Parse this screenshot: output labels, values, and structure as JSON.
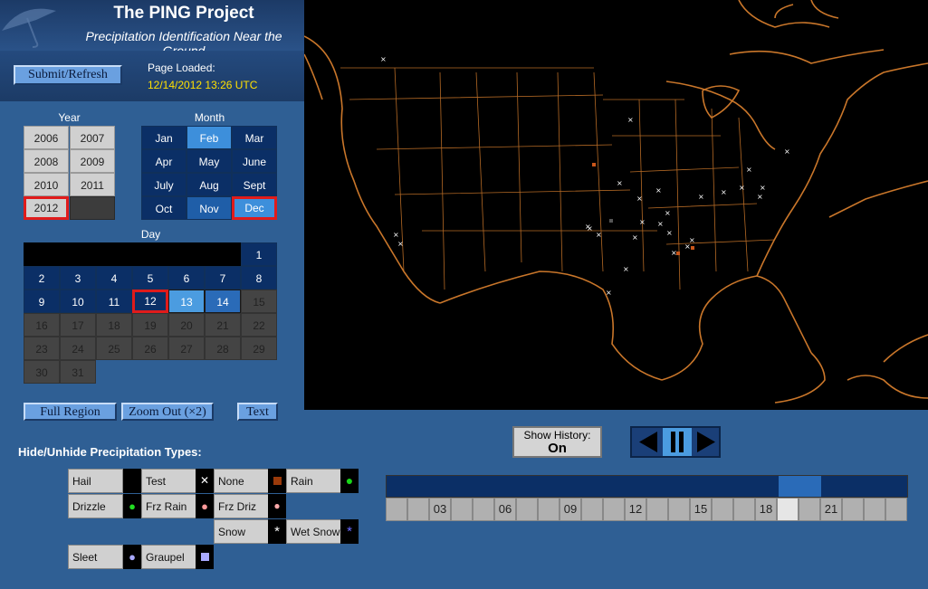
{
  "header": {
    "title": "The PING Project",
    "subtitle": "Precipitation Identification Near the Ground"
  },
  "toolbar": {
    "submit_label": "Submit/Refresh",
    "loaded_label": "Page Loaded:",
    "loaded_value": "12/14/2012 13:26 UTC"
  },
  "year": {
    "label": "Year",
    "options": [
      "2006",
      "2007",
      "2008",
      "2009",
      "2010",
      "2011",
      "2012"
    ],
    "selected": "2012"
  },
  "month": {
    "label": "Month",
    "options": [
      "Jan",
      "Feb",
      "Mar",
      "Apr",
      "May",
      "June",
      "July",
      "Aug",
      "Sept",
      "Oct",
      "Nov",
      "Dec"
    ],
    "selected": "Dec"
  },
  "day": {
    "label": "Day",
    "days": [
      "1",
      "2",
      "3",
      "4",
      "5",
      "6",
      "7",
      "8",
      "9",
      "10",
      "11",
      "12",
      "13",
      "14",
      "15",
      "16",
      "17",
      "18",
      "19",
      "20",
      "21",
      "22",
      "23",
      "24",
      "25",
      "26",
      "27",
      "28",
      "29",
      "30",
      "31"
    ],
    "selected": "12"
  },
  "buttons": {
    "full_region": "Full Region",
    "zoom_out": "Zoom Out (×2)",
    "text": "Text"
  },
  "precip": {
    "label": "Hide/Unhide Precipitation Types:",
    "types": {
      "hail": "Hail",
      "test": "Test",
      "none": "None",
      "rain": "Rain",
      "drizzle": "Drizzle",
      "frz_rain": "Frz Rain",
      "frz_driz": "Frz Driz",
      "snow": "Snow",
      "wet_snow": "Wet Snow",
      "sleet": "Sleet",
      "graupel": "Graupel"
    }
  },
  "history": {
    "label": "Show History:",
    "value": "On"
  },
  "timeline": {
    "hour_labels": [
      "03",
      "06",
      "09",
      "12",
      "15",
      "18",
      "21"
    ]
  },
  "colors": {
    "map_border": "#c9762a",
    "accent_selected": "#e01b1b",
    "loaded_time": "#ffe000"
  }
}
